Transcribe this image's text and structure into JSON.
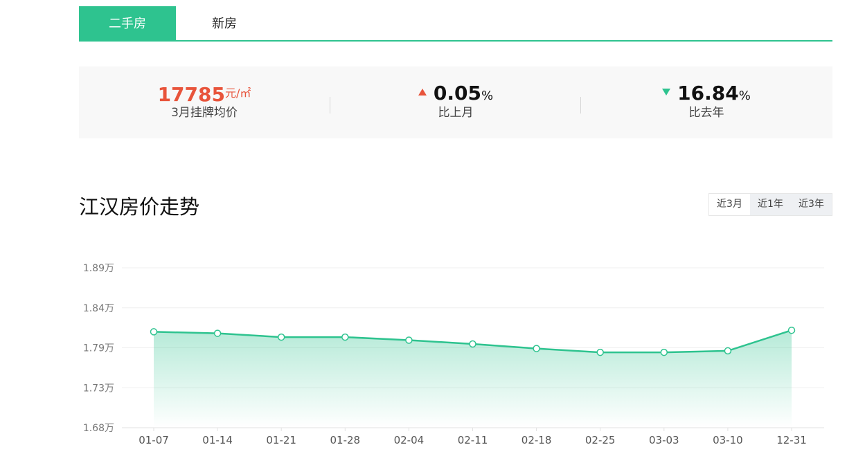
{
  "tabs": {
    "active": "二手房",
    "inactive": "新房"
  },
  "stats": {
    "avg_price": {
      "value": "17785",
      "unit": "元/㎡",
      "label": "3月挂牌均价"
    },
    "mom": {
      "value": "0.05",
      "unit": "%",
      "label": "比上月",
      "direction": "up"
    },
    "yoy": {
      "value": "16.84",
      "unit": "%",
      "label": "比去年",
      "direction": "down"
    }
  },
  "section_title": "江汉房价走势",
  "range_buttons": [
    "近3月",
    "近1年",
    "近3年"
  ],
  "range_selected": "近3月",
  "colors": {
    "accent": "#2ec38f",
    "up": "#e8543b",
    "down": "#2ec38f"
  },
  "chart_data": {
    "type": "area",
    "categories": [
      "01-07",
      "01-14",
      "01-21",
      "01-28",
      "02-04",
      "02-11",
      "02-18",
      "02-25",
      "03-03",
      "03-10",
      "12-31"
    ],
    "values": [
      1.806,
      1.804,
      1.799,
      1.799,
      1.795,
      1.79,
      1.784,
      1.779,
      1.779,
      1.781,
      1.808
    ],
    "y_ticks": [
      "1.68万",
      "1.73万",
      "1.79万",
      "1.84万",
      "1.89万"
    ],
    "ylim": [
      1.68,
      1.89
    ],
    "grid": true,
    "legend": "none"
  }
}
